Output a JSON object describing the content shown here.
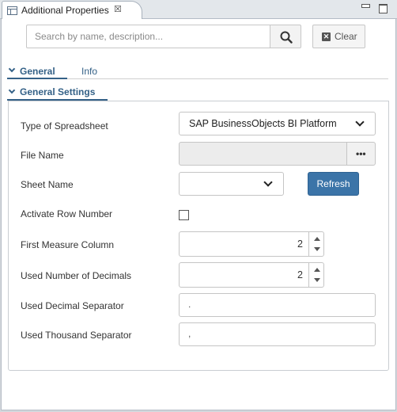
{
  "window": {
    "tab_title": "Additional Properties",
    "close_glyph": "☒"
  },
  "search": {
    "placeholder": "Search by name, description...",
    "clear_label": "Clear",
    "clear_glyph": "✕"
  },
  "tabs": {
    "general": "General",
    "info": "Info"
  },
  "section": {
    "title": "General Settings"
  },
  "fields": {
    "type_of_spreadsheet": {
      "label": "Type of Spreadsheet",
      "value": "SAP BusinessObjects BI Platform"
    },
    "file_name": {
      "label": "File Name",
      "value": "",
      "browse_glyph": "•••"
    },
    "sheet_name": {
      "label": "Sheet Name",
      "value": "",
      "refresh_label": "Refresh"
    },
    "activate_row_number": {
      "label": "Activate Row Number",
      "checked": false
    },
    "first_measure_column": {
      "label": "First Measure Column",
      "value": "2"
    },
    "used_number_of_decimals": {
      "label": "Used Number of Decimals",
      "value": "2"
    },
    "used_decimal_separator": {
      "label": "Used Decimal Separator",
      "value": "."
    },
    "used_thousand_separator": {
      "label": "Used Thousand Separator",
      "value": ","
    }
  },
  "colors": {
    "accent": "#346187",
    "button_primary": "#3b74a8"
  }
}
